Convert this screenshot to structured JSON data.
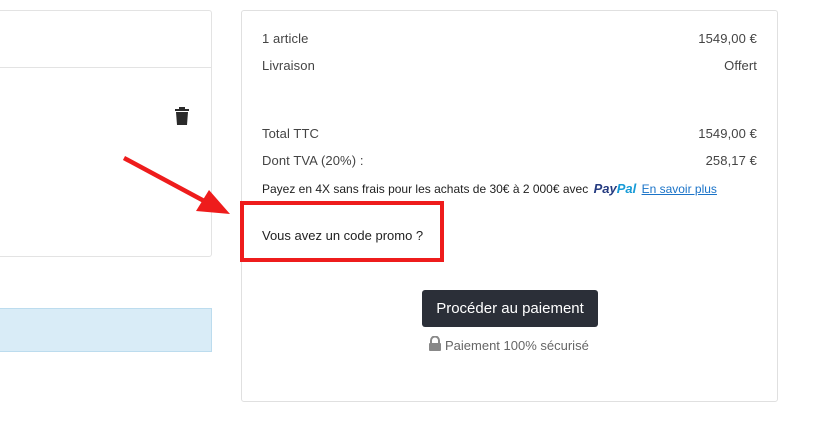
{
  "summary": {
    "items_label": "1 article",
    "items_value": "1549,00 €",
    "shipping_label": "Livraison",
    "shipping_value": "Offert",
    "total_label": "Total TTC",
    "total_value": "1549,00 €",
    "vat_label": "Dont TVA (20%) :",
    "vat_value": "258,17 €",
    "paypal_text": "Payez en 4X sans frais pour les achats de 30€ à 2 000€ avec",
    "paypal_logo_part1": "Pay",
    "paypal_logo_part2": "Pal",
    "learn_more": "En savoir plus",
    "promo_label": "Vous avez un code promo ?",
    "checkout_button": "Procéder au paiement",
    "secure_label": "Paiement 100% sécurisé"
  },
  "icons": {
    "trash": "trash-icon",
    "lock": "lock-icon",
    "annotation_arrow": "arrow-icon"
  },
  "colors": {
    "annotation_red": "#ee1c1c",
    "button_dark": "#2b2f38",
    "info_bar": "#d9ecf7",
    "link_blue": "#1a73c8",
    "paypal_dark": "#253b80",
    "paypal_light": "#179bd7"
  }
}
